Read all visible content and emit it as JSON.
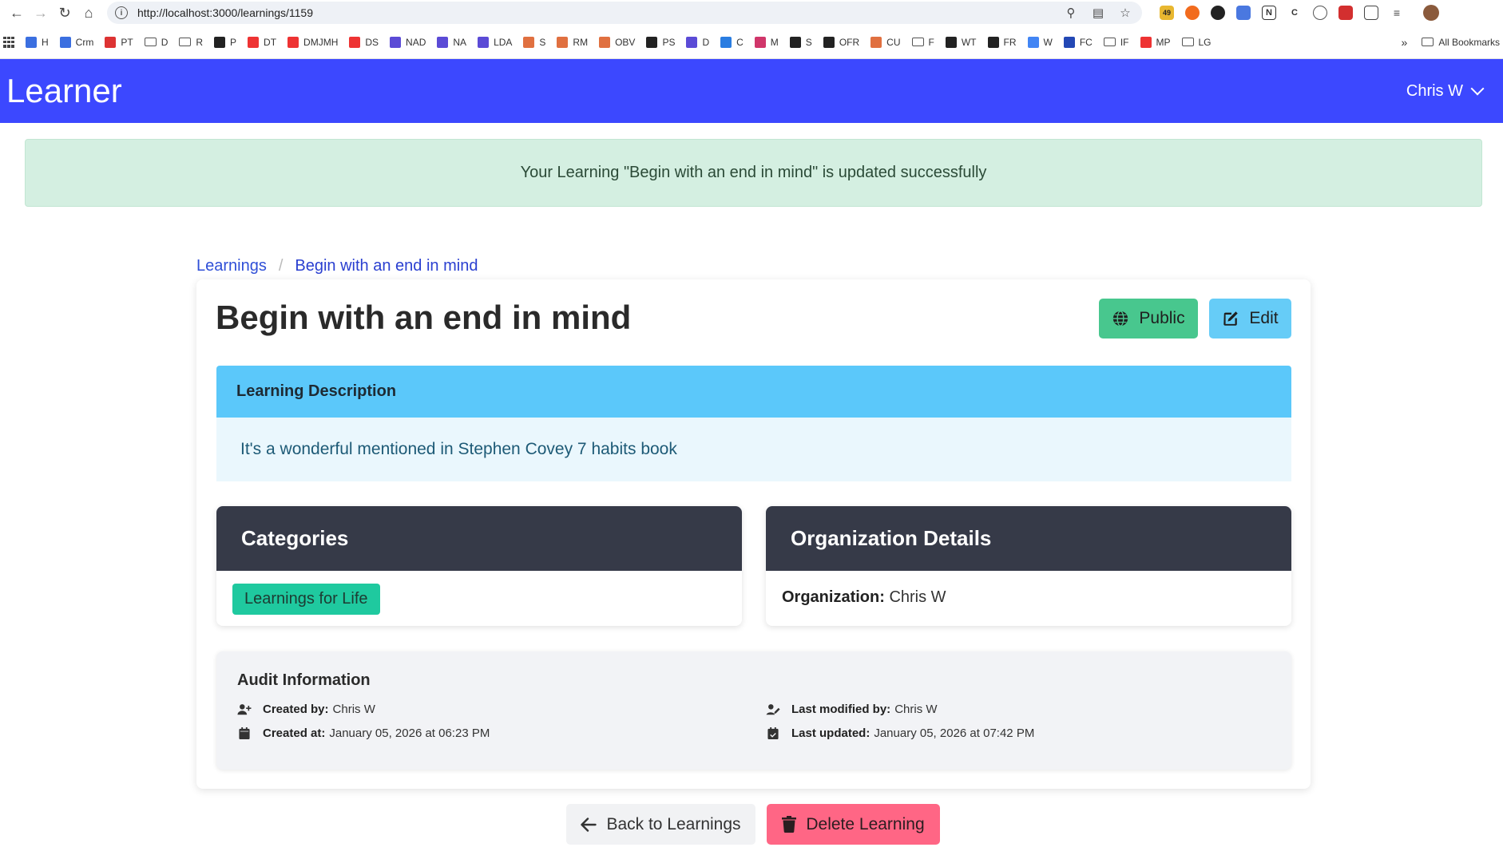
{
  "browser": {
    "url": "http://localhost:3000/learnings/1159",
    "ext_badge": "49",
    "bookmarks": [
      {
        "label": "H",
        "color": "#3b6fe0"
      },
      {
        "label": "Crm",
        "color": "#3b6fe0"
      },
      {
        "label": "PT",
        "color": "#d33"
      },
      {
        "label": "D",
        "color": "folder"
      },
      {
        "label": "R",
        "color": "folder"
      },
      {
        "label": "P",
        "color": "#222"
      },
      {
        "label": "DT",
        "color": "#e33"
      },
      {
        "label": "DMJMH",
        "color": "#e33"
      },
      {
        "label": "DS",
        "color": "#e33"
      },
      {
        "label": "NAD",
        "color": "#5b4bd6"
      },
      {
        "label": "NA",
        "color": "#5b4bd6"
      },
      {
        "label": "LDA",
        "color": "#5b4bd6"
      },
      {
        "label": "S",
        "color": "#e07040"
      },
      {
        "label": "RM",
        "color": "#e07040"
      },
      {
        "label": "OBV",
        "color": "#e07040"
      },
      {
        "label": "PS",
        "color": "#222"
      },
      {
        "label": "D",
        "color": "#5b4bd6"
      },
      {
        "label": "C",
        "color": "#2a7de1"
      },
      {
        "label": "M",
        "color": "#d0366a"
      },
      {
        "label": "S",
        "color": "#222"
      },
      {
        "label": "OFR",
        "color": "#222"
      },
      {
        "label": "CU",
        "color": "#e07040"
      },
      {
        "label": "F",
        "color": "folder"
      },
      {
        "label": "WT",
        "color": "#222"
      },
      {
        "label": "FR",
        "color": "#222"
      },
      {
        "label": "W",
        "color": "#4285f4"
      },
      {
        "label": "FC",
        "color": "#2348b5"
      },
      {
        "label": "IF",
        "color": "folder"
      },
      {
        "label": "MP",
        "color": "#e33"
      },
      {
        "label": "LG",
        "color": "folder"
      }
    ],
    "more_bookmarks": "»",
    "all_bookmarks": "All Bookmarks"
  },
  "navbar": {
    "brand": "Learner",
    "user": "Chris W",
    "color": "#3c48ff"
  },
  "notification": {
    "message": "Your Learning \"Begin with an end in mind\" is updated successfully"
  },
  "breadcrumb": {
    "root": "Learnings",
    "separator": "/",
    "current": "Begin with an end in mind"
  },
  "learning": {
    "title": "Begin with an end in mind",
    "public_label": "Public",
    "edit_label": "Edit",
    "description_heading": "Learning Description",
    "description": "It's a wonderful mentioned in Stephen Covey 7 habits book"
  },
  "categories": {
    "heading": "Categories",
    "items": [
      "Learnings for Life"
    ]
  },
  "organization": {
    "heading": "Organization Details",
    "label": "Organization:",
    "value": "Chris W"
  },
  "audit": {
    "heading": "Audit Information",
    "created_by_label": "Created by:",
    "created_by": "Chris W",
    "created_at_label": "Created at:",
    "created_at": "January 05, 2026 at 06:23 PM",
    "modified_by_label": "Last modified by:",
    "modified_by": "Chris W",
    "updated_label": "Last updated:",
    "updated_at": "January 05, 2026 at 07:42 PM"
  },
  "actions": {
    "back_label": "Back to Learnings",
    "delete_label": "Delete Learning"
  }
}
